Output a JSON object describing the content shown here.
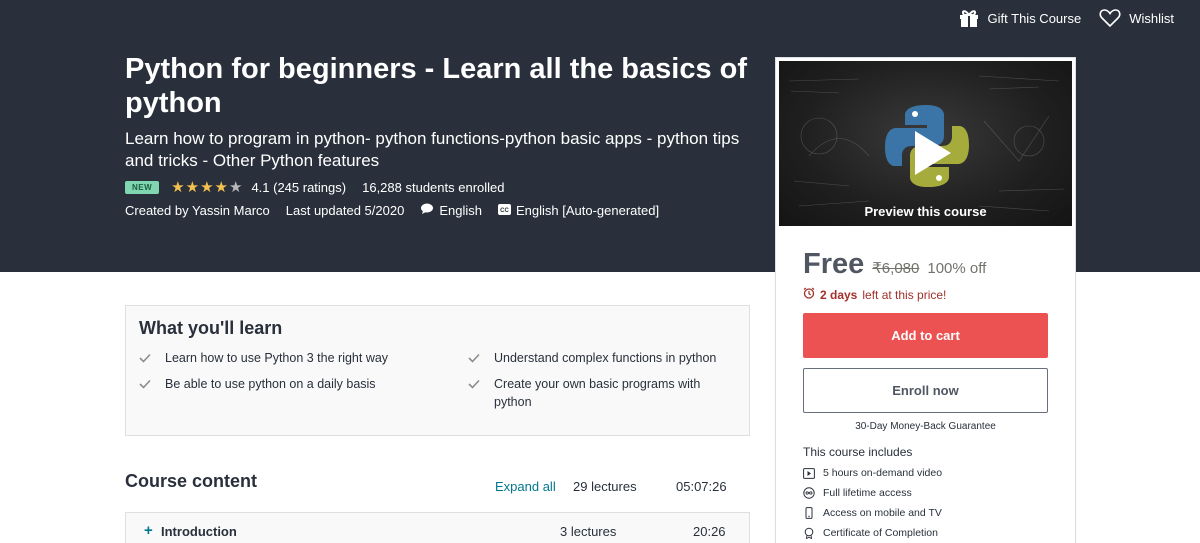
{
  "topbar": {
    "gift_label": "Gift This Course",
    "wishlist_label": "Wishlist"
  },
  "course": {
    "title": "Python for beginners - Learn all the basics of python",
    "subtitle": "Learn how to program in python- python functions-python basic apps - python tips and tricks - Other Python features",
    "badge": "NEW",
    "rating": 4.1,
    "rating_text": "4.1 (245 ratings)",
    "students": "16,288 students enrolled",
    "created_by": "Created by Yassin Marco",
    "last_updated": "Last updated 5/2020",
    "language": "English",
    "captions": "English [Auto-generated]"
  },
  "sidebar": {
    "preview_label": "Preview this course",
    "price": "Free",
    "original_price": "₹6,080",
    "discount": "100% off",
    "timer_bold": "2 days",
    "timer_rest": "left at this price!",
    "add_to_cart": "Add to cart",
    "enroll_now": "Enroll now",
    "guarantee": "30-Day Money-Back Guarantee",
    "includes_title": "This course includes",
    "includes": [
      {
        "icon": "video-icon",
        "label": "5 hours on-demand video"
      },
      {
        "icon": "infinity-icon",
        "label": "Full lifetime access"
      },
      {
        "icon": "mobile-icon",
        "label": "Access on mobile and TV"
      },
      {
        "icon": "certificate-icon",
        "label": "Certificate of Completion"
      }
    ]
  },
  "learn": {
    "title": "What you'll learn",
    "items": [
      "Learn how to use Python 3 the right way",
      "Understand complex functions in python",
      "Be able to use python on a daily basis",
      "Create your own basic programs with python"
    ]
  },
  "content": {
    "title": "Course content",
    "expand_all": "Expand all",
    "lectures": "29 lectures",
    "duration": "05:07:26",
    "sections": [
      {
        "name": "Introduction",
        "lectures": "3 lectures",
        "duration": "20:26"
      }
    ]
  },
  "colors": {
    "hero_bg": "#29303b",
    "accent_red": "#ec5252",
    "link_blue": "#007791",
    "star": "#f4c150",
    "timer_red": "#a1312a"
  }
}
